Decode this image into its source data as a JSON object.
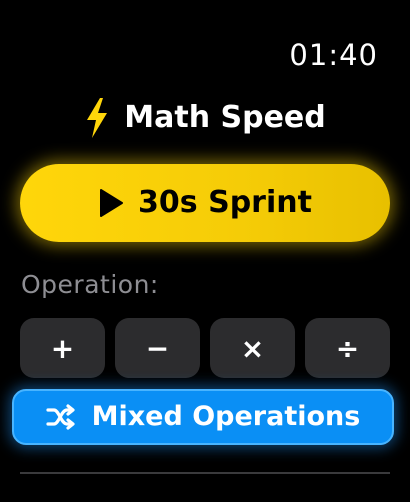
{
  "status": {
    "time": "01:40"
  },
  "header": {
    "title": "Math Speed",
    "icon": "bolt-icon",
    "icon_color": "#ffd60a"
  },
  "sprint": {
    "label": "30s Sprint",
    "icon": "play-icon",
    "color": "#ffd60a"
  },
  "operations": {
    "label": "Operation:",
    "items": [
      {
        "symbol": "+",
        "name": "add"
      },
      {
        "symbol": "−",
        "name": "subtract"
      },
      {
        "symbol": "×",
        "name": "multiply"
      },
      {
        "symbol": "÷",
        "name": "divide"
      }
    ],
    "button_color": "#2c2c2e"
  },
  "mixed": {
    "label": "Mixed Operations",
    "icon": "shuffle-icon",
    "color": "#0a8ff5"
  }
}
